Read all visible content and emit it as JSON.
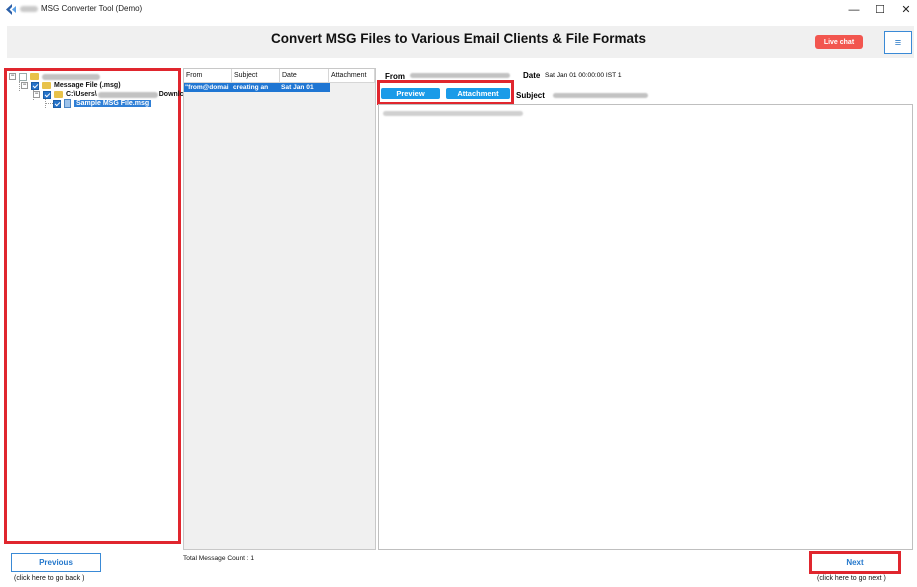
{
  "window": {
    "title": "MSG Converter Tool (Demo)",
    "min_glyph": "—",
    "max_glyph": "☐",
    "close_glyph": "✕",
    "icon": "app-logo-icon"
  },
  "header": {
    "title": "Convert MSG Files to Various Email Clients & File Formats",
    "live_chat_label": "Live chat",
    "menu_glyph": "≡",
    "live_chat_color": "#f2564f"
  },
  "tree": {
    "message_file_label": "Message File (.msg)",
    "path_prefix": "C:\\Users\\",
    "path_suffix": "Downlc",
    "file_label": "Sample MSG File.msg"
  },
  "message_list": {
    "columns": [
      "From",
      "Subject",
      "Date",
      "Attachment"
    ],
    "rows": [
      {
        "from": "\"from@domai",
        "subject": "creating an",
        "date": "Sat Jan 01",
        "attachment": ""
      }
    ],
    "total_label": "Total Message Count : 1"
  },
  "preview": {
    "from_label": "From",
    "date_label": "Date",
    "date_value": "Sat Jan 01 00:00:00 IST 1",
    "subject_label": "Subject",
    "tabs": [
      "Preview",
      "Attachment"
    ]
  },
  "footer": {
    "previous_label": "Previous",
    "previous_hint": "(click here to  go back )",
    "next_label": "Next",
    "next_hint": "(click here to  go next )"
  },
  "colors": {
    "accent": "#1a9be8",
    "highlight_border": "#e0262e",
    "selection": "#1f76d3"
  }
}
